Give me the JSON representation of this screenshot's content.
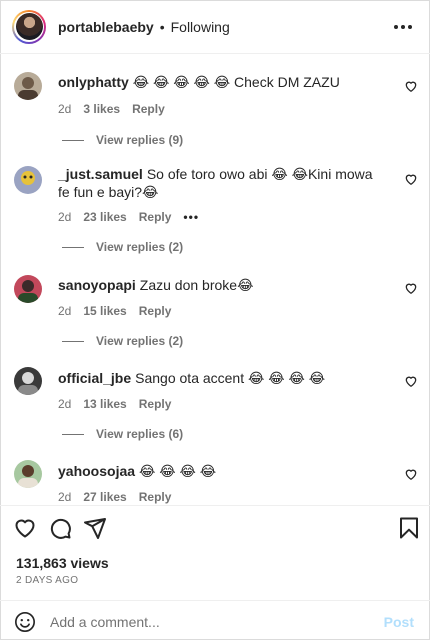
{
  "header": {
    "username": "portablebaeby",
    "separator": "•",
    "follow_status": "Following"
  },
  "comments": [
    {
      "username": "onlyphatty",
      "text": "😂 😂 😂 😂 😂  Check DM ZAZU",
      "age": "2d",
      "likes": "3 likes",
      "reply": "Reply",
      "view_replies": "View replies (9)",
      "avatar_color": "#b8ab98"
    },
    {
      "username": "_just.samuel",
      "text": "So ofe toro owo abi 😂 😂Kini mowa fe fun e bayi?😂",
      "age": "2d",
      "likes": "23 likes",
      "reply": "Reply",
      "options": "•••",
      "view_replies": "View replies (2)",
      "avatar_color": "#9aa3c2"
    },
    {
      "username": "sanoyopapi",
      "text": "Zazu don broke😂",
      "age": "2d",
      "likes": "15 likes",
      "reply": "Reply",
      "view_replies": "View replies (2)",
      "avatar_color": "#c2485b"
    },
    {
      "username": "official_jbe",
      "text": "Sango ota accent 😂 😂 😂 😂",
      "age": "2d",
      "likes": "13 likes",
      "reply": "Reply",
      "view_replies": "View replies (6)",
      "avatar_color": "#3a3a3a"
    },
    {
      "username": "yahoosojaa",
      "text": "😂 😂 😂 😂",
      "age": "2d",
      "likes": "27 likes",
      "reply": "Reply",
      "avatar_color": "#a7c8a0"
    }
  ],
  "stats": {
    "views": "131,863 views",
    "posted": "2 DAYS AGO"
  },
  "add_comment": {
    "placeholder": "Add a comment...",
    "post_label": "Post"
  },
  "icons": {
    "more": "more-options-icon",
    "like": "heart-icon",
    "comment": "comment-icon",
    "share": "share-icon",
    "save": "bookmark-icon",
    "emoji": "emoji-icon"
  },
  "colors": {
    "text": "#262626",
    "muted": "#737373",
    "post_disabled": "#b2dffc"
  }
}
